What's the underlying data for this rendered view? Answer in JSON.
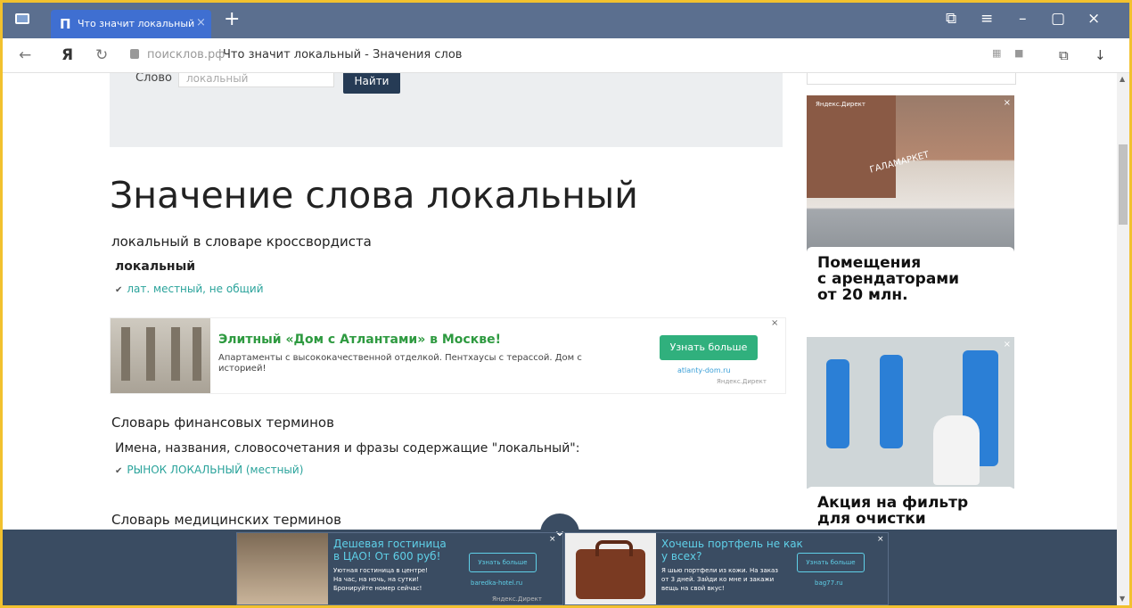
{
  "browser": {
    "tab_title": "Что значит локальный",
    "tab_close": "×",
    "new_tab": "+",
    "host": "поисклов.рф",
    "page_title": "Что значит локальный - Значения слов"
  },
  "search": {
    "label": "Слово",
    "value": "локальный",
    "button": "Найти"
  },
  "main": {
    "heading": "Значение слова локальный",
    "section1": "локальный в словаре кроссвордиста",
    "term": "локальный",
    "term_def": "лат. местный, не общий",
    "section2": "Словарь финансовых терминов",
    "section2_sub": "Имена, названия, словосочетания и фразы содержащие \"локальный\":",
    "section2_link": "РЫНОК ЛОКАЛЬНЫЙ (местный)",
    "section3": "Словарь медицинских терминов"
  },
  "inline_ad": {
    "title": "Элитный «Дом с Атлантами» в Москве!",
    "text": "Апартаменты с высококачественной отделкой. Пентхаусы с терассой. Дом с историей!",
    "cta": "Узнать больше",
    "domain": "atlanty-dom.ru",
    "network": "Яндекс.Директ",
    "close": "×"
  },
  "side_ads": [
    {
      "caption": "Помещения\nс арендаторами\nот 20 млн.",
      "network": "Яндекс.Директ",
      "close": "×"
    },
    {
      "caption": "Акция на фильтр\nдля очистки",
      "close": "×"
    }
  ],
  "bottom_ads": [
    {
      "headline": "Дешевая гостиница\nв ЦАО! От 600 руб!",
      "desc": "Уютная гостиница в центре!\nНа час, на ночь, на сутки!\nБронируйте номер сейчас!",
      "cta": "Узнать больше",
      "domain": "baredka-hotel.ru",
      "network": "Яндекс.Директ",
      "close": "×"
    },
    {
      "headline": "Хочешь портфель не как\nу всех?",
      "desc": "Я шью портфели из кожи. На заказ\nот 3 дней. Зайди ко мне и закажи\nвещь на свой вкус!",
      "cta": "Узнать больше",
      "domain": "bag77.ru",
      "close": "×"
    }
  ],
  "icons": {
    "back": "←",
    "yandex": "Я",
    "reload": "↻",
    "download": "↓",
    "minimize": "–",
    "maximize": "☐",
    "close": "×",
    "menu": "≡",
    "chevron": "⌄"
  },
  "colors": {
    "frame": "#f2c12e",
    "tabbar": "#5b6f8f",
    "link": "#2aa39b",
    "ad_title": "#2e9a40",
    "cta": "#30b07d",
    "bottom_bar": "#3a4c62"
  }
}
